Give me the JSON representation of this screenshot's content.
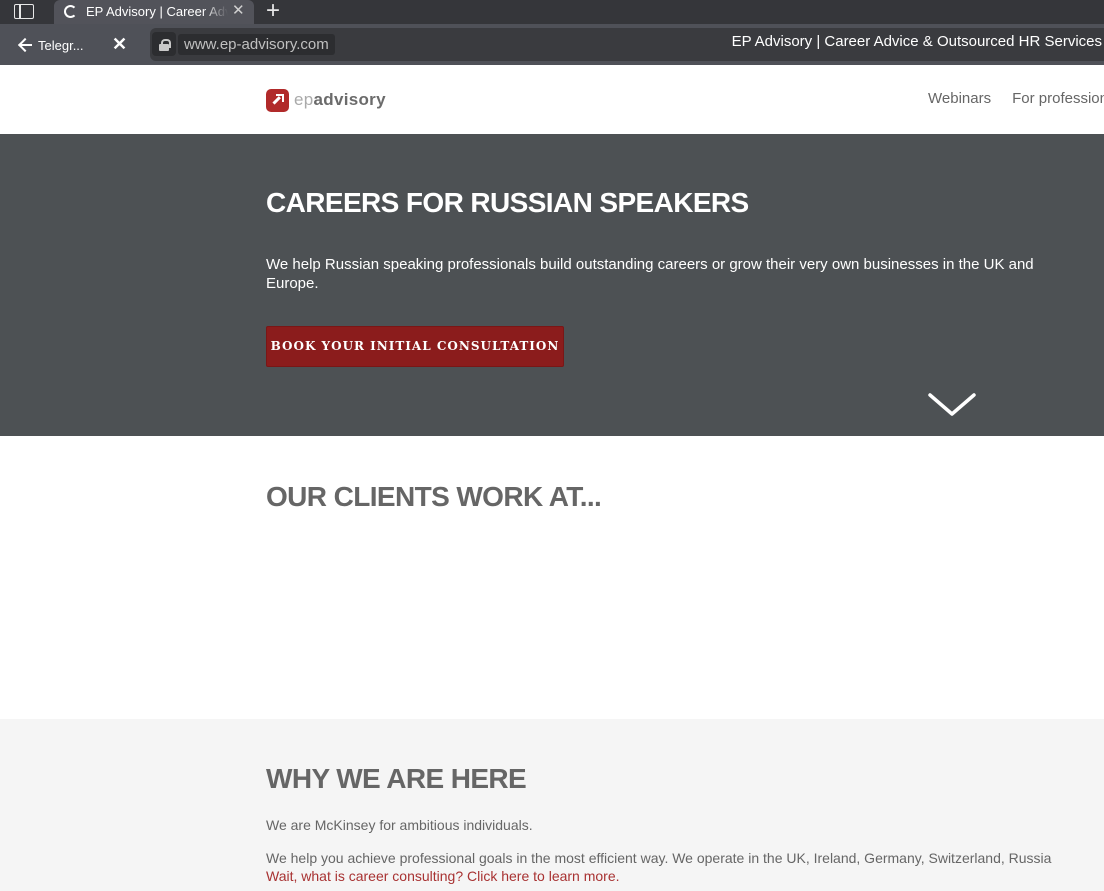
{
  "browser": {
    "tab_title": "EP Advisory | Career Advice & Outsourced HR Services",
    "back_label": "Telegr...",
    "url": "www.ep-advisory.com",
    "page_title": "EP Advisory | Career Advice & Outsourced HR Services",
    "close_glyph": "✕",
    "tab_close_glyph": "✕",
    "new_tab_glyph": "+"
  },
  "header": {
    "logo_ep": "ep",
    "logo_advisory": "advisory",
    "nav": [
      "Webinars",
      "For professionals"
    ]
  },
  "hero": {
    "title": "CAREERS FOR RUSSIAN SPEAKERS",
    "subtitle": "We help Russian speaking professionals build outstanding careers or grow their very own businesses in the UK and Europe.",
    "cta": "BOOK YOUR INITIAL CONSULTATION"
  },
  "clients": {
    "title": "OUR CLIENTS WORK AT..."
  },
  "why": {
    "title": "WHY WE ARE HERE",
    "p1": "We are McKinsey for ambitious individuals.",
    "p2": "We help you achieve professional goals in the most efficient way. We operate in the UK, Ireland, Germany, Switzerland, Russia",
    "link": "Wait, what is career consulting? Click here to learn more."
  },
  "colors": {
    "accent": "#8b1c1c",
    "hero_bg": "#4d5154",
    "link": "#a83232"
  }
}
